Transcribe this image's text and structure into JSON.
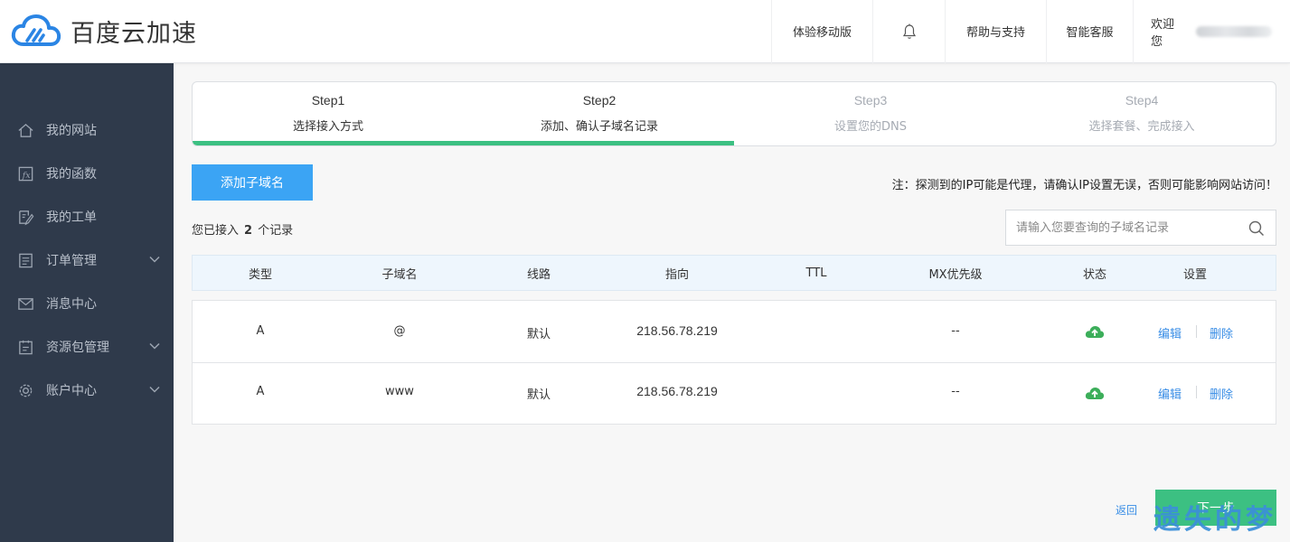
{
  "header": {
    "logo_text": "百度云加速",
    "nav": {
      "mobile": "体验移动版",
      "help": "帮助与支持",
      "service": "智能客服",
      "welcome": "欢迎您"
    }
  },
  "sidebar": {
    "items": [
      {
        "label": "我的网站",
        "icon": "home-icon"
      },
      {
        "label": "我的函数",
        "icon": "function-icon"
      },
      {
        "label": "我的工单",
        "icon": "ticket-icon"
      },
      {
        "label": "订单管理",
        "icon": "order-icon"
      },
      {
        "label": "消息中心",
        "icon": "mail-icon"
      },
      {
        "label": "资源包管理",
        "icon": "package-icon"
      },
      {
        "label": "账户中心",
        "icon": "gear-icon"
      }
    ]
  },
  "steps": [
    {
      "title": "Step1",
      "label": "选择接入方式",
      "state": "active"
    },
    {
      "title": "Step2",
      "label": "添加、确认子域名记录",
      "state": "active"
    },
    {
      "title": "Step3",
      "label": "设置您的DNS",
      "state": "inactive"
    },
    {
      "title": "Step4",
      "label": "选择套餐、完成接入",
      "state": "inactive"
    }
  ],
  "progress_fraction": 0.5,
  "toolbar": {
    "add_button": "添加子域名",
    "note": "注：探测到的IP可能是代理，请确认IP设置无误，否则可能影响网站访问！"
  },
  "records": {
    "count_prefix": "您已接入",
    "count": "2",
    "count_suffix": "个记录",
    "search_placeholder": "请输入您要查询的子域名记录"
  },
  "table": {
    "headers": [
      "类型",
      "子域名",
      "线路",
      "指向",
      "TTL",
      "MX优先级",
      "状态",
      "设置"
    ],
    "rows": [
      {
        "type": "A",
        "subdomain": "@",
        "line": "默认",
        "target": "218.56.78.219",
        "ttl": "",
        "mx": "--",
        "status": "cloud-upload-icon",
        "edit": "编辑",
        "delete": "删除"
      },
      {
        "type": "A",
        "subdomain": "www",
        "line": "默认",
        "target": "218.56.78.219",
        "ttl": "",
        "mx": "--",
        "status": "cloud-upload-icon",
        "edit": "编辑",
        "delete": "删除"
      }
    ]
  },
  "footer": {
    "back": "返回",
    "next": "下一步",
    "watermark": "遗失的梦"
  },
  "colors": {
    "sidebar_bg": "#2f3a4b",
    "accent_blue": "#3ba4f4",
    "accent_green": "#3cc082",
    "link": "#3a8ee6"
  }
}
